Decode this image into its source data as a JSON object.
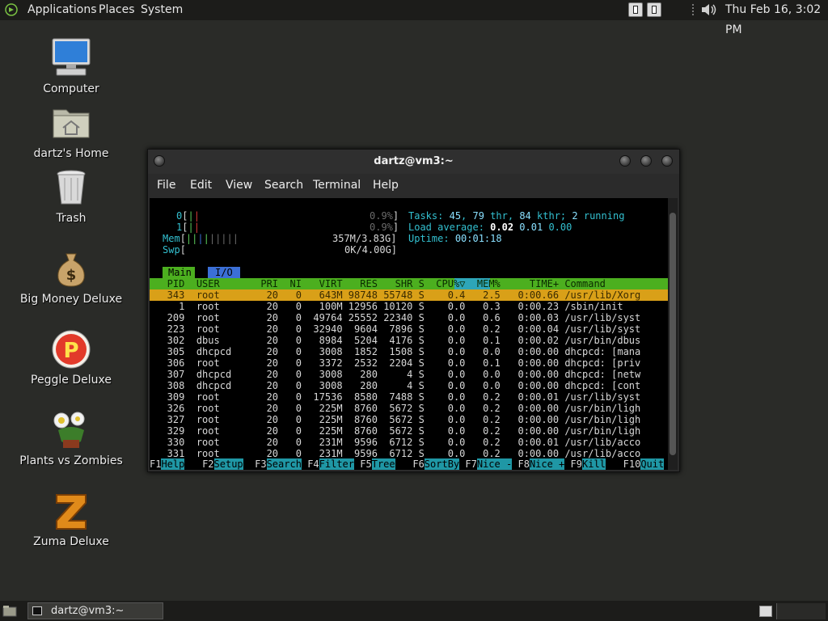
{
  "top_panel": {
    "menus": [
      "Applications",
      "Places",
      "System"
    ],
    "clock": "Thu Feb 16,  3:02 PM"
  },
  "desktop_icons": [
    {
      "label": "Computer",
      "icon": "computer-icon"
    },
    {
      "label": "dartz's Home",
      "icon": "home-folder-icon"
    },
    {
      "label": "Trash",
      "icon": "trash-icon"
    },
    {
      "label": "Big Money Deluxe",
      "icon": "money-bag-icon"
    },
    {
      "label": "Peggle Deluxe",
      "icon": "peggle-icon"
    },
    {
      "label": "Plants vs Zombies",
      "icon": "plants-icon"
    },
    {
      "label": "Zuma Deluxe",
      "icon": "zuma-icon"
    }
  ],
  "window": {
    "title": "dartz@vm3:~",
    "menu": [
      "File",
      "Edit",
      "View",
      "Search",
      "Terminal",
      "Help"
    ]
  },
  "htop": {
    "meters": {
      "cpu0": {
        "label": "0",
        "value": "0.9%"
      },
      "cpu1": {
        "label": "1",
        "value": "0.9%"
      },
      "mem": {
        "label": "Mem",
        "value": "357M/3.83G"
      },
      "swp": {
        "label": "Swp",
        "value": "0K/4.00G"
      }
    },
    "tasks": {
      "label": "Tasks:",
      "count": "45",
      "thr": "79",
      "thr_label": "thr,",
      "kthr": "84",
      "kthr_label": "kthr;",
      "running": "2",
      "running_label": "running"
    },
    "load": {
      "label": "Load average:",
      "v1": "0.02",
      "v2": "0.01",
      "v3": "0.00"
    },
    "uptime": {
      "label": "Uptime:",
      "value": "00:01:18"
    },
    "tabs": [
      "Main",
      "I/O"
    ],
    "columns": [
      "PID",
      "USER",
      "PRI",
      "NI",
      "VIRT",
      "RES",
      "SHR",
      "S",
      "CPU%▽",
      "MEM%",
      "TIME+",
      "Command"
    ],
    "rows": [
      {
        "pid": "343",
        "user": "root",
        "pri": "20",
        "ni": "0",
        "virt": "643M",
        "res": "98748",
        "shr": "55748",
        "s": "S",
        "cpu": "0.4",
        "mem": "2.5",
        "time": "0:00.66",
        "cmd": "/usr/lib/Xorg"
      },
      {
        "pid": "1",
        "user": "root",
        "pri": "20",
        "ni": "0",
        "virt": "100M",
        "res": "12956",
        "shr": "10120",
        "s": "S",
        "cpu": "0.0",
        "mem": "0.3",
        "time": "0:00.23",
        "cmd": "/sbin/init"
      },
      {
        "pid": "209",
        "user": "root",
        "pri": "20",
        "ni": "0",
        "virt": "49764",
        "res": "25552",
        "shr": "22340",
        "s": "S",
        "cpu": "0.0",
        "mem": "0.6",
        "time": "0:00.03",
        "cmd": "/usr/lib/syst"
      },
      {
        "pid": "223",
        "user": "root",
        "pri": "20",
        "ni": "0",
        "virt": "32940",
        "res": "9604",
        "shr": "7896",
        "s": "S",
        "cpu": "0.0",
        "mem": "0.2",
        "time": "0:00.04",
        "cmd": "/usr/lib/syst"
      },
      {
        "pid": "302",
        "user": "dbus",
        "pri": "20",
        "ni": "0",
        "virt": "8984",
        "res": "5204",
        "shr": "4176",
        "s": "S",
        "cpu": "0.0",
        "mem": "0.1",
        "time": "0:00.02",
        "cmd": "/usr/bin/dbus"
      },
      {
        "pid": "305",
        "user": "dhcpcd",
        "pri": "20",
        "ni": "0",
        "virt": "3008",
        "res": "1852",
        "shr": "1508",
        "s": "S",
        "cpu": "0.0",
        "mem": "0.0",
        "time": "0:00.00",
        "cmd": "dhcpcd: [mana"
      },
      {
        "pid": "306",
        "user": "root",
        "pri": "20",
        "ni": "0",
        "virt": "3372",
        "res": "2532",
        "shr": "2204",
        "s": "S",
        "cpu": "0.0",
        "mem": "0.1",
        "time": "0:00.00",
        "cmd": "dhcpcd: [priv"
      },
      {
        "pid": "307",
        "user": "dhcpcd",
        "pri": "20",
        "ni": "0",
        "virt": "3008",
        "res": "280",
        "shr": "4",
        "s": "S",
        "cpu": "0.0",
        "mem": "0.0",
        "time": "0:00.00",
        "cmd": "dhcpcd: [netw"
      },
      {
        "pid": "308",
        "user": "dhcpcd",
        "pri": "20",
        "ni": "0",
        "virt": "3008",
        "res": "280",
        "shr": "4",
        "s": "S",
        "cpu": "0.0",
        "mem": "0.0",
        "time": "0:00.00",
        "cmd": "dhcpcd: [cont"
      },
      {
        "pid": "309",
        "user": "root",
        "pri": "20",
        "ni": "0",
        "virt": "17536",
        "res": "8580",
        "shr": "7488",
        "s": "S",
        "cpu": "0.0",
        "mem": "0.2",
        "time": "0:00.01",
        "cmd": "/usr/lib/syst"
      },
      {
        "pid": "326",
        "user": "root",
        "pri": "20",
        "ni": "0",
        "virt": "225M",
        "res": "8760",
        "shr": "5672",
        "s": "S",
        "cpu": "0.0",
        "mem": "0.2",
        "time": "0:00.00",
        "cmd": "/usr/bin/ligh"
      },
      {
        "pid": "327",
        "user": "root",
        "pri": "20",
        "ni": "0",
        "virt": "225M",
        "res": "8760",
        "shr": "5672",
        "s": "S",
        "cpu": "0.0",
        "mem": "0.2",
        "time": "0:00.00",
        "cmd": "/usr/bin/ligh"
      },
      {
        "pid": "329",
        "user": "root",
        "pri": "20",
        "ni": "0",
        "virt": "225M",
        "res": "8760",
        "shr": "5672",
        "s": "S",
        "cpu": "0.0",
        "mem": "0.2",
        "time": "0:00.00",
        "cmd": "/usr/bin/ligh"
      },
      {
        "pid": "330",
        "user": "root",
        "pri": "20",
        "ni": "0",
        "virt": "231M",
        "res": "9596",
        "shr": "6712",
        "s": "S",
        "cpu": "0.0",
        "mem": "0.2",
        "time": "0:00.01",
        "cmd": "/usr/lib/acco"
      },
      {
        "pid": "331",
        "user": "root",
        "pri": "20",
        "ni": "0",
        "virt": "231M",
        "res": "9596",
        "shr": "6712",
        "s": "S",
        "cpu": "0.0",
        "mem": "0.2",
        "time": "0:00.00",
        "cmd": "/usr/lib/acco"
      }
    ],
    "fkeys": [
      {
        "key": "F1",
        "label": "Help  "
      },
      {
        "key": "F2",
        "label": "Setup "
      },
      {
        "key": "F3",
        "label": "Search"
      },
      {
        "key": "F4",
        "label": "Filter"
      },
      {
        "key": "F5",
        "label": "Tree  "
      },
      {
        "key": "F6",
        "label": "SortBy"
      },
      {
        "key": "F7",
        "label": "Nice -"
      },
      {
        "key": "F8",
        "label": "Nice +"
      },
      {
        "key": "F9",
        "label": "Kill  "
      },
      {
        "key": "F10",
        "label": "Quit"
      }
    ]
  },
  "taskbar": {
    "item": "dartz@vm3:~"
  }
}
